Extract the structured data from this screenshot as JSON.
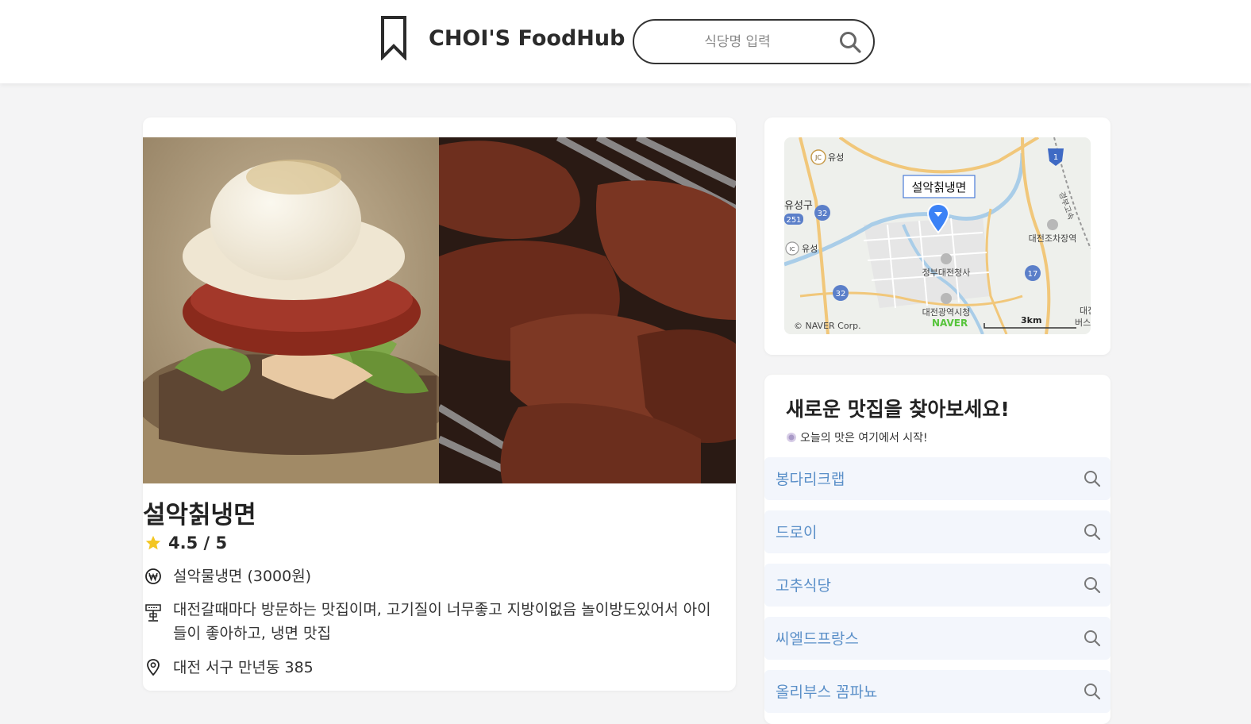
{
  "header": {
    "brand": "CHOI'S FoodHub",
    "search_placeholder": "식당명 입력"
  },
  "restaurant": {
    "name": "설악칡냉면",
    "rating": "4.5 / 5",
    "menu": "설악물냉면 (3000원)",
    "description": "대전갈때마다 방문하는 맛집이며, 고기질이 너무좋고 지방이없음 놀이방도있어서 아이들이 좋아하고, 냉면 맛집",
    "address": "대전 서구 만년동 385"
  },
  "map": {
    "marker_label": "설악칡냉면",
    "labels": {
      "yuseong_top": "유성",
      "seogu": "유성구",
      "yuseong_ic": "유성",
      "gov_complex": "정부대전청사",
      "city_hall": "대전광역시청",
      "depot": "대전조차장역",
      "edge": "대전",
      "bus": "버스",
      "highway": "경부고속",
      "naver": "NAVER",
      "copyright": "© NAVER Corp.",
      "scale": "3km"
    },
    "shields": {
      "jc": "JC",
      "ic": "IC",
      "r32": "32",
      "r251": "251",
      "r17": "17",
      "r1": "1"
    }
  },
  "sidebar": {
    "title": "새로운 맛집을 찾아보세요!",
    "subtitle": "오늘의 맛은 여기에서 시작!",
    "items": [
      {
        "label": "봉다리크랩"
      },
      {
        "label": "드로이"
      },
      {
        "label": "고추식당"
      },
      {
        "label": "씨엘드프랑스"
      },
      {
        "label": "올리부스 꼼파뇨"
      }
    ]
  },
  "colors": {
    "accent_link": "#5a8fc8",
    "rec_bg": "#f3f6fc",
    "star": "#f3c623",
    "map_marker": "#3b82f6"
  }
}
